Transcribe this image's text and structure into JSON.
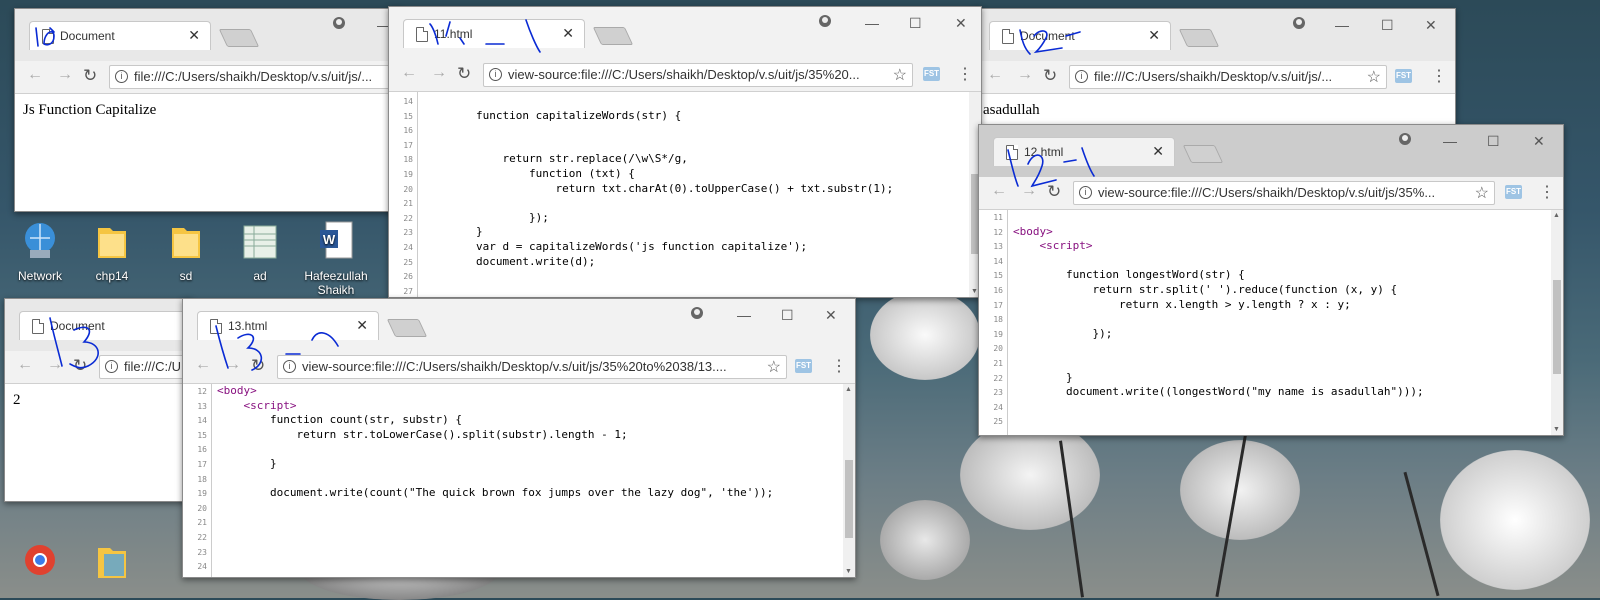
{
  "colors": {
    "scribble": "#0a2bd4",
    "tag": "#881280",
    "folder": "#f5c542"
  },
  "desktop": {
    "icons": [
      {
        "label": "Network",
        "icon": "network-icon"
      },
      {
        "label": "chp14",
        "icon": "folder-icon"
      },
      {
        "label": "sd",
        "icon": "folder-icon"
      },
      {
        "label": "ad",
        "icon": "spreadsheet-icon"
      },
      {
        "label": "Hafeezullah Shaikh",
        "icon": "word-document-icon"
      }
    ]
  },
  "windows": {
    "win1": {
      "tab": "Document",
      "url": "file:///C:/Users/shaikh/Desktop/v.s/uit/js/...",
      "body": "Js Function Capitalize"
    },
    "win11": {
      "tab": "11.html",
      "url": "view-source:file:///C:/Users/shaikh/Desktop/v.s/uit/js/35%20...",
      "lines": [
        {
          "n": "14",
          "code": ""
        },
        {
          "n": "15",
          "code": "        function capitalizeWords(str) {"
        },
        {
          "n": "16",
          "code": ""
        },
        {
          "n": "17",
          "code": ""
        },
        {
          "n": "18",
          "code": "            return str.replace(/\\w\\S*/g,"
        },
        {
          "n": "19",
          "code": "                function (txt) {"
        },
        {
          "n": "20",
          "code": "                    return txt.charAt(0).toUpperCase() + txt.substr(1);"
        },
        {
          "n": "21",
          "code": ""
        },
        {
          "n": "22",
          "code": "                });"
        },
        {
          "n": "23",
          "code": "        }"
        },
        {
          "n": "24",
          "code": "        var d = capitalizeWords('js function capitalize');"
        },
        {
          "n": "25",
          "code": "        document.write(d);"
        },
        {
          "n": "26",
          "code": ""
        },
        {
          "n": "27",
          "code": ""
        }
      ]
    },
    "win2": {
      "tab": "Document",
      "url": "file:///C:/Users/shaikh/Desktop/v.s/uit/js/...",
      "body": "asadullah"
    },
    "win12": {
      "tab": "12.html",
      "url": "view-source:file:///C:/Users/shaikh/Desktop/v.s/uit/js/35%...",
      "lines": [
        {
          "n": "11",
          "code": ""
        },
        {
          "n": "12",
          "code": "<body>"
        },
        {
          "n": "13",
          "code": "    <script>"
        },
        {
          "n": "14",
          "code": ""
        },
        {
          "n": "15",
          "code": "        function longestWord(str) {"
        },
        {
          "n": "16",
          "code": "            return str.split(' ').reduce(function (x, y) {"
        },
        {
          "n": "17",
          "code": "                return x.length > y.length ? x : y;"
        },
        {
          "n": "18",
          "code": ""
        },
        {
          "n": "19",
          "code": "            });"
        },
        {
          "n": "20",
          "code": ""
        },
        {
          "n": "21",
          "code": ""
        },
        {
          "n": "22",
          "code": "        }"
        },
        {
          "n": "23",
          "code": "        document.write((longestWord(\"my name is asadullah\")));"
        },
        {
          "n": "24",
          "code": ""
        },
        {
          "n": "25",
          "code": ""
        }
      ]
    },
    "win3": {
      "tab": "Document",
      "url": "file:///C:/U",
      "body": "2"
    },
    "win13": {
      "tab": "13.html",
      "url": "view-source:file:///C:/Users/shaikh/Desktop/v.s/uit/js/35%20to%2038/13....",
      "lines": [
        {
          "n": "12",
          "code": "<body>"
        },
        {
          "n": "13",
          "code": "    <script>"
        },
        {
          "n": "14",
          "code": "        function count(str, substr) {"
        },
        {
          "n": "15",
          "code": "            return str.toLowerCase().split(substr).length - 1;"
        },
        {
          "n": "16",
          "code": ""
        },
        {
          "n": "17",
          "code": "        }"
        },
        {
          "n": "18",
          "code": ""
        },
        {
          "n": "19",
          "code": "        document.write(count(\"The quick brown fox jumps over the lazy dog\", 'the'));"
        },
        {
          "n": "20",
          "code": ""
        },
        {
          "n": "21",
          "code": ""
        },
        {
          "n": "22",
          "code": ""
        },
        {
          "n": "23",
          "code": ""
        },
        {
          "n": "24",
          "code": ""
        }
      ]
    }
  }
}
